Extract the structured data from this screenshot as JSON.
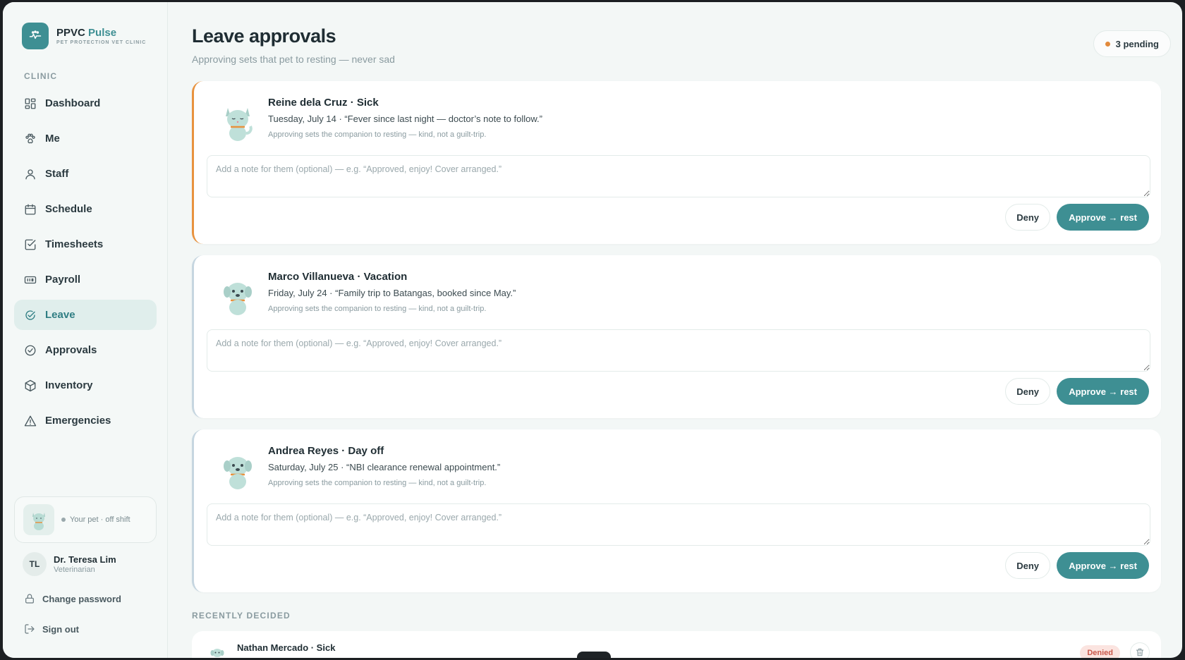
{
  "brand": {
    "name_prefix": "PPVC",
    "name_accent": "Pulse",
    "subtitle": "PET PROTECTION VET CLINIC"
  },
  "sidebar": {
    "section_label": "CLINIC",
    "items": [
      {
        "label": "Dashboard",
        "icon": "dashboard-icon"
      },
      {
        "label": "Me",
        "icon": "paw-icon"
      },
      {
        "label": "Staff",
        "icon": "person-icon"
      },
      {
        "label": "Schedule",
        "icon": "calendar-icon"
      },
      {
        "label": "Timesheets",
        "icon": "checkbox-icon"
      },
      {
        "label": "Payroll",
        "icon": "payroll-icon"
      },
      {
        "label": "Leave",
        "icon": "leave-icon",
        "active": true
      },
      {
        "label": "Approvals",
        "icon": "check-circle-icon"
      },
      {
        "label": "Inventory",
        "icon": "box-icon"
      },
      {
        "label": "Emergencies",
        "icon": "warning-icon"
      }
    ],
    "pet_status": "Your pet · off shift",
    "user": {
      "initials": "TL",
      "name": "Dr. Teresa Lim",
      "role": "Veterinarian"
    },
    "change_password": "Change password",
    "sign_out": "Sign out"
  },
  "header": {
    "title": "Leave approvals",
    "subtitle": "Approving sets that pet to resting — never sad",
    "pending": "3 pending"
  },
  "requests": [
    {
      "title": "Reine dela Cruz · Sick",
      "desc": "Tuesday, July 14 · “Fever since last night — doctor’s note to follow.”",
      "hint": "Approving sets the companion to resting — kind, not a guilt-trip.",
      "note_placeholder": "Add a note for them (optional) — e.g. “Approved, enjoy! Cover arranged.”",
      "deny_label": "Deny",
      "approve_label": "Approve → rest",
      "pet": "cat"
    },
    {
      "title": "Marco Villanueva · Vacation",
      "desc": "Friday, July 24 · “Family trip to Batangas, booked since May.”",
      "hint": "Approving sets the companion to resting — kind, not a guilt-trip.",
      "note_placeholder": "Add a note for them (optional) — e.g. “Approved, enjoy! Cover arranged.”",
      "deny_label": "Deny",
      "approve_label": "Approve → rest",
      "pet": "dog"
    },
    {
      "title": "Andrea Reyes · Day off",
      "desc": "Saturday, July 25 · “NBI clearance renewal appointment.”",
      "hint": "Approving sets the companion to resting — kind, not a guilt-trip.",
      "note_placeholder": "Add a note for them (optional) — e.g. “Approved, enjoy! Cover arranged.”",
      "deny_label": "Deny",
      "approve_label": "Approve → rest",
      "pet": "dog"
    }
  ],
  "recent": {
    "label": "RECENTLY DECIDED",
    "items": [
      {
        "title": "Nathan Mercado · Sick",
        "status": "Denied"
      }
    ]
  },
  "colors": {
    "accent": "#3e8f93",
    "pending_dot": "#e28a3c",
    "highlight_border": "#e8923e",
    "denied_bg": "#fbe4e0",
    "denied_text": "#c9574a"
  }
}
